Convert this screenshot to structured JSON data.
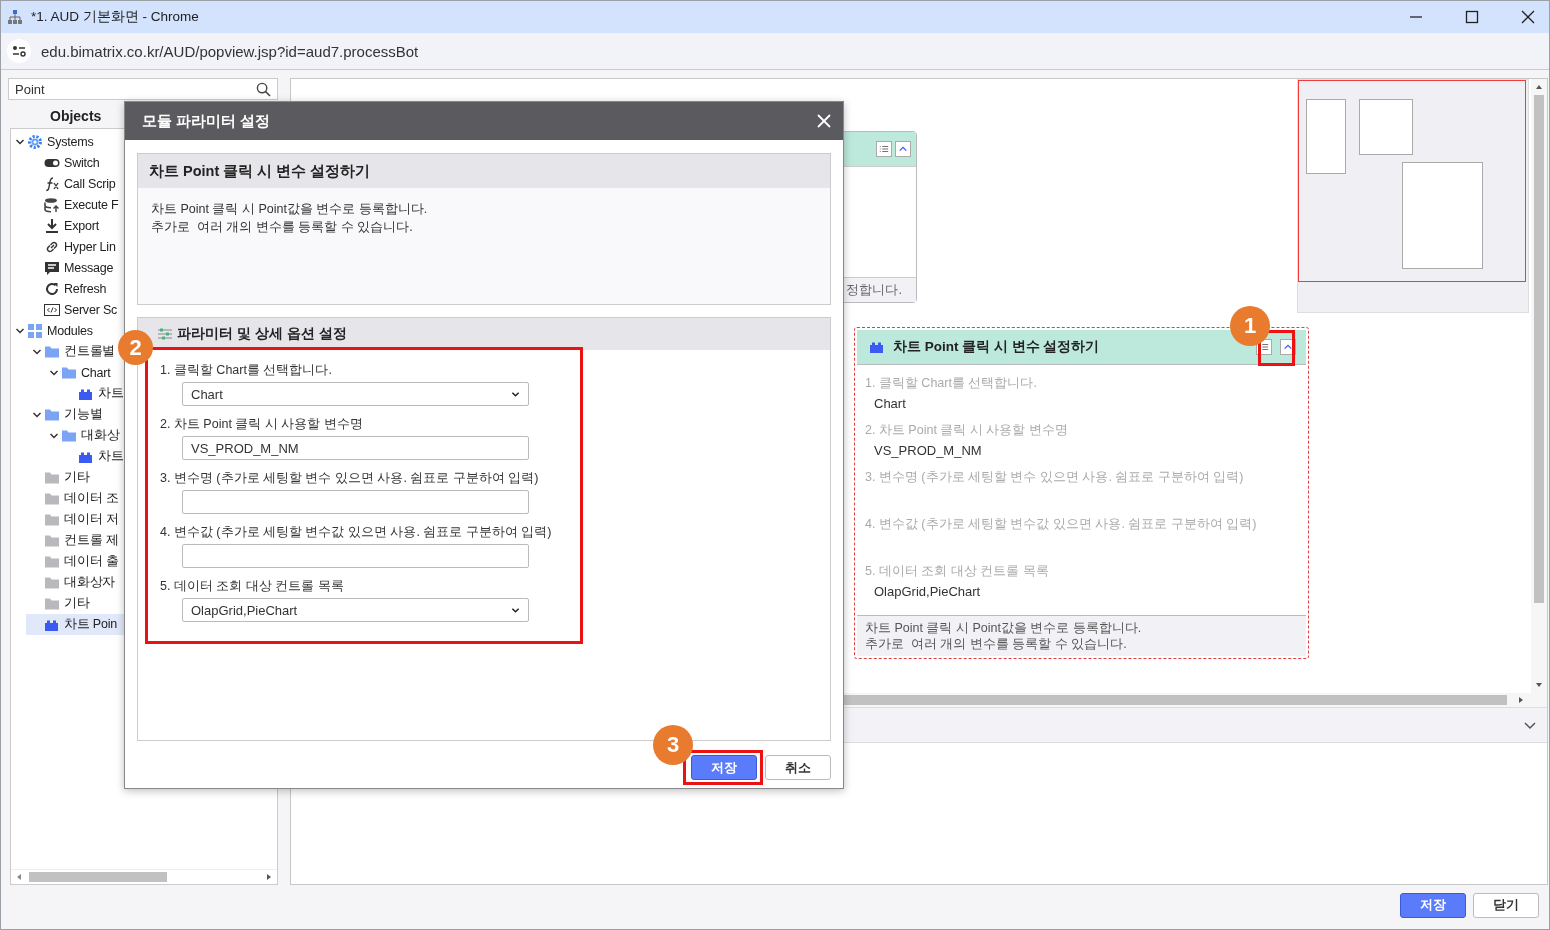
{
  "window": {
    "title": "*1. AUD 기본화면 - Chrome"
  },
  "address_bar": {
    "url": "edu.bimatrix.co.kr/AUD/popview.jsp?id=aud7.processBot"
  },
  "search": {
    "value": "Point"
  },
  "objects_panel": {
    "title": "Objects",
    "tree": [
      {
        "label": "Systems",
        "kind": "gear",
        "expanded": true,
        "selected": false,
        "children": [
          {
            "label": "Switch",
            "kind": "toggle",
            "selected": false
          },
          {
            "label": "Call Scrip",
            "kind": "function",
            "selected": false
          },
          {
            "label": "Execute F",
            "kind": "database",
            "selected": false
          },
          {
            "label": "Export",
            "kind": "download",
            "selected": false
          },
          {
            "label": "Hyper Lin",
            "kind": "link",
            "selected": false
          },
          {
            "label": "Message",
            "kind": "message",
            "selected": false
          },
          {
            "label": "Refresh",
            "kind": "refresh",
            "selected": false
          },
          {
            "label": "Server Sc",
            "kind": "code",
            "selected": false
          }
        ]
      },
      {
        "label": "Modules",
        "kind": "modules",
        "expanded": true,
        "selected": false,
        "children": [
          {
            "label": "컨트롤별",
            "kind": "folder",
            "expanded": true,
            "selected": false,
            "children": [
              {
                "label": "Chart",
                "kind": "folder",
                "expanded": true,
                "selected": false,
                "children": [
                  {
                    "label": "차트",
                    "kind": "module",
                    "selected": false
                  }
                ]
              }
            ]
          },
          {
            "label": "기능별",
            "kind": "folder",
            "expanded": true,
            "selected": false,
            "children": [
              {
                "label": "대화상",
                "kind": "folder",
                "expanded": true,
                "selected": false,
                "children": [
                  {
                    "label": "차트",
                    "kind": "module",
                    "selected": false
                  }
                ]
              }
            ]
          },
          {
            "label": "기타",
            "kind": "folder_gray",
            "selected": false
          },
          {
            "label": "데이터 조",
            "kind": "folder_gray",
            "selected": false
          },
          {
            "label": "데이터 저",
            "kind": "folder_gray",
            "selected": false
          },
          {
            "label": "컨트롤 제",
            "kind": "folder_gray",
            "selected": false
          },
          {
            "label": "데이터 출",
            "kind": "folder_gray",
            "selected": false
          },
          {
            "label": "대화상자",
            "kind": "folder_gray",
            "selected": false
          },
          {
            "label": "기타",
            "kind": "folder_gray",
            "selected": false
          },
          {
            "label": "차트 Poin",
            "kind": "module",
            "selected": true
          }
        ]
      }
    ]
  },
  "canvas": {
    "partial_node": {
      "footer_text": "정합니다."
    },
    "node": {
      "title": "차트 Point 클릭 시 변수 설정하기",
      "annotation": "1",
      "rows": [
        {
          "label": "1. 클릭할 Chart를 선택합니다.",
          "value": "Chart"
        },
        {
          "label": "2. 차트 Point 클릭 시 사용할 변수명",
          "value": "VS_PROD_M_NM"
        },
        {
          "label": "3. 변수명 (추가로 세팅할 변수 있으면 사용. 쉼표로 구분하여 입력)"
        },
        {
          "label": "4. 변수값 (추가로 세팅할 변수값 있으면 사용. 쉼표로 구분하여 입력)"
        },
        {
          "label": "5. 데이터 조회 대상 컨트롤 목록",
          "value": "OlapGrid,PieChart"
        }
      ],
      "description": [
        "차트 Point 클릭 시 Point값을 변수로 등록합니다.",
        "추가로  여러 개의 변수를 등록할 수 있습니다."
      ]
    }
  },
  "dialog": {
    "title": "모듈 파라미터 설정",
    "summary": {
      "title": "차트 Point 클릭 시 변수 설정하기",
      "description": [
        "차트 Point 클릭 시 Point값을 변수로 등록합니다.",
        "추가로  여러 개의 변수를 등록할 수 있습니다."
      ]
    },
    "params": {
      "title": "파라미터 및 상세 옵션 설정",
      "annotation": "2",
      "fields": [
        {
          "label": "1. 클릭할 Chart를 선택합니다.",
          "kind": "select",
          "value": "Chart"
        },
        {
          "label": "2. 차트 Point 클릭 시 사용할 변수명",
          "kind": "text",
          "value": "VS_PROD_M_NM"
        },
        {
          "label": "3. 변수명 (추가로 세팅할 변수 있으면 사용. 쉼표로 구분하여 입력)",
          "kind": "text"
        },
        {
          "label": "4. 변수값 (추가로 세팅할 변수값 있으면 사용. 쉼표로 구분하여 입력)",
          "kind": "text"
        },
        {
          "label": "5. 데이터 조회 대상 컨트롤 목록",
          "kind": "select",
          "value": "OlapGrid,PieChart"
        }
      ]
    },
    "buttons": [
      {
        "label": "저장",
        "kind": "primary",
        "annotation": "3"
      },
      {
        "label": "취소",
        "kind": "default"
      }
    ]
  },
  "footer_buttons": [
    {
      "label": "저장",
      "kind": "primary"
    },
    {
      "label": "닫기",
      "kind": "default"
    }
  ]
}
